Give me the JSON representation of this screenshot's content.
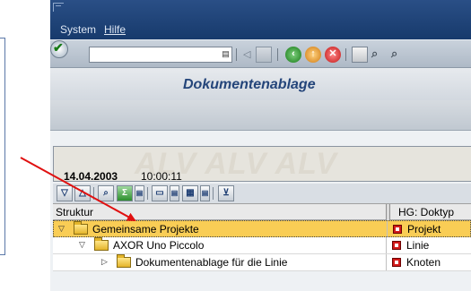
{
  "menu": {
    "items": [
      {
        "label": "System"
      },
      {
        "label": "Hilfe"
      }
    ]
  },
  "toolbar": {
    "command_field_value": ""
  },
  "page": {
    "title": "Dokumentenablage"
  },
  "alv": {
    "watermark": "ALV ALV ALV",
    "date": "14.04.2003",
    "time": "10:00:11",
    "columns": [
      "Struktur",
      "HG: Doktyp"
    ],
    "rows": [
      {
        "label": "Gemeinsame Projekte",
        "type": "Projekt",
        "level": 0,
        "expanded": true,
        "selected": true
      },
      {
        "label": "AXOR Uno Piccolo",
        "type": "Linie",
        "level": 1,
        "expanded": true,
        "selected": false
      },
      {
        "label": "Dokumentenablage für die Linie",
        "type": "Knoten",
        "level": 2,
        "expanded": false,
        "selected": false
      }
    ]
  },
  "colors": {
    "menubar": "#173a6c",
    "title": "#24457a",
    "selected_row": "#f9cd55",
    "arrow": "#e01010",
    "type_icon": "#d21a1a"
  }
}
